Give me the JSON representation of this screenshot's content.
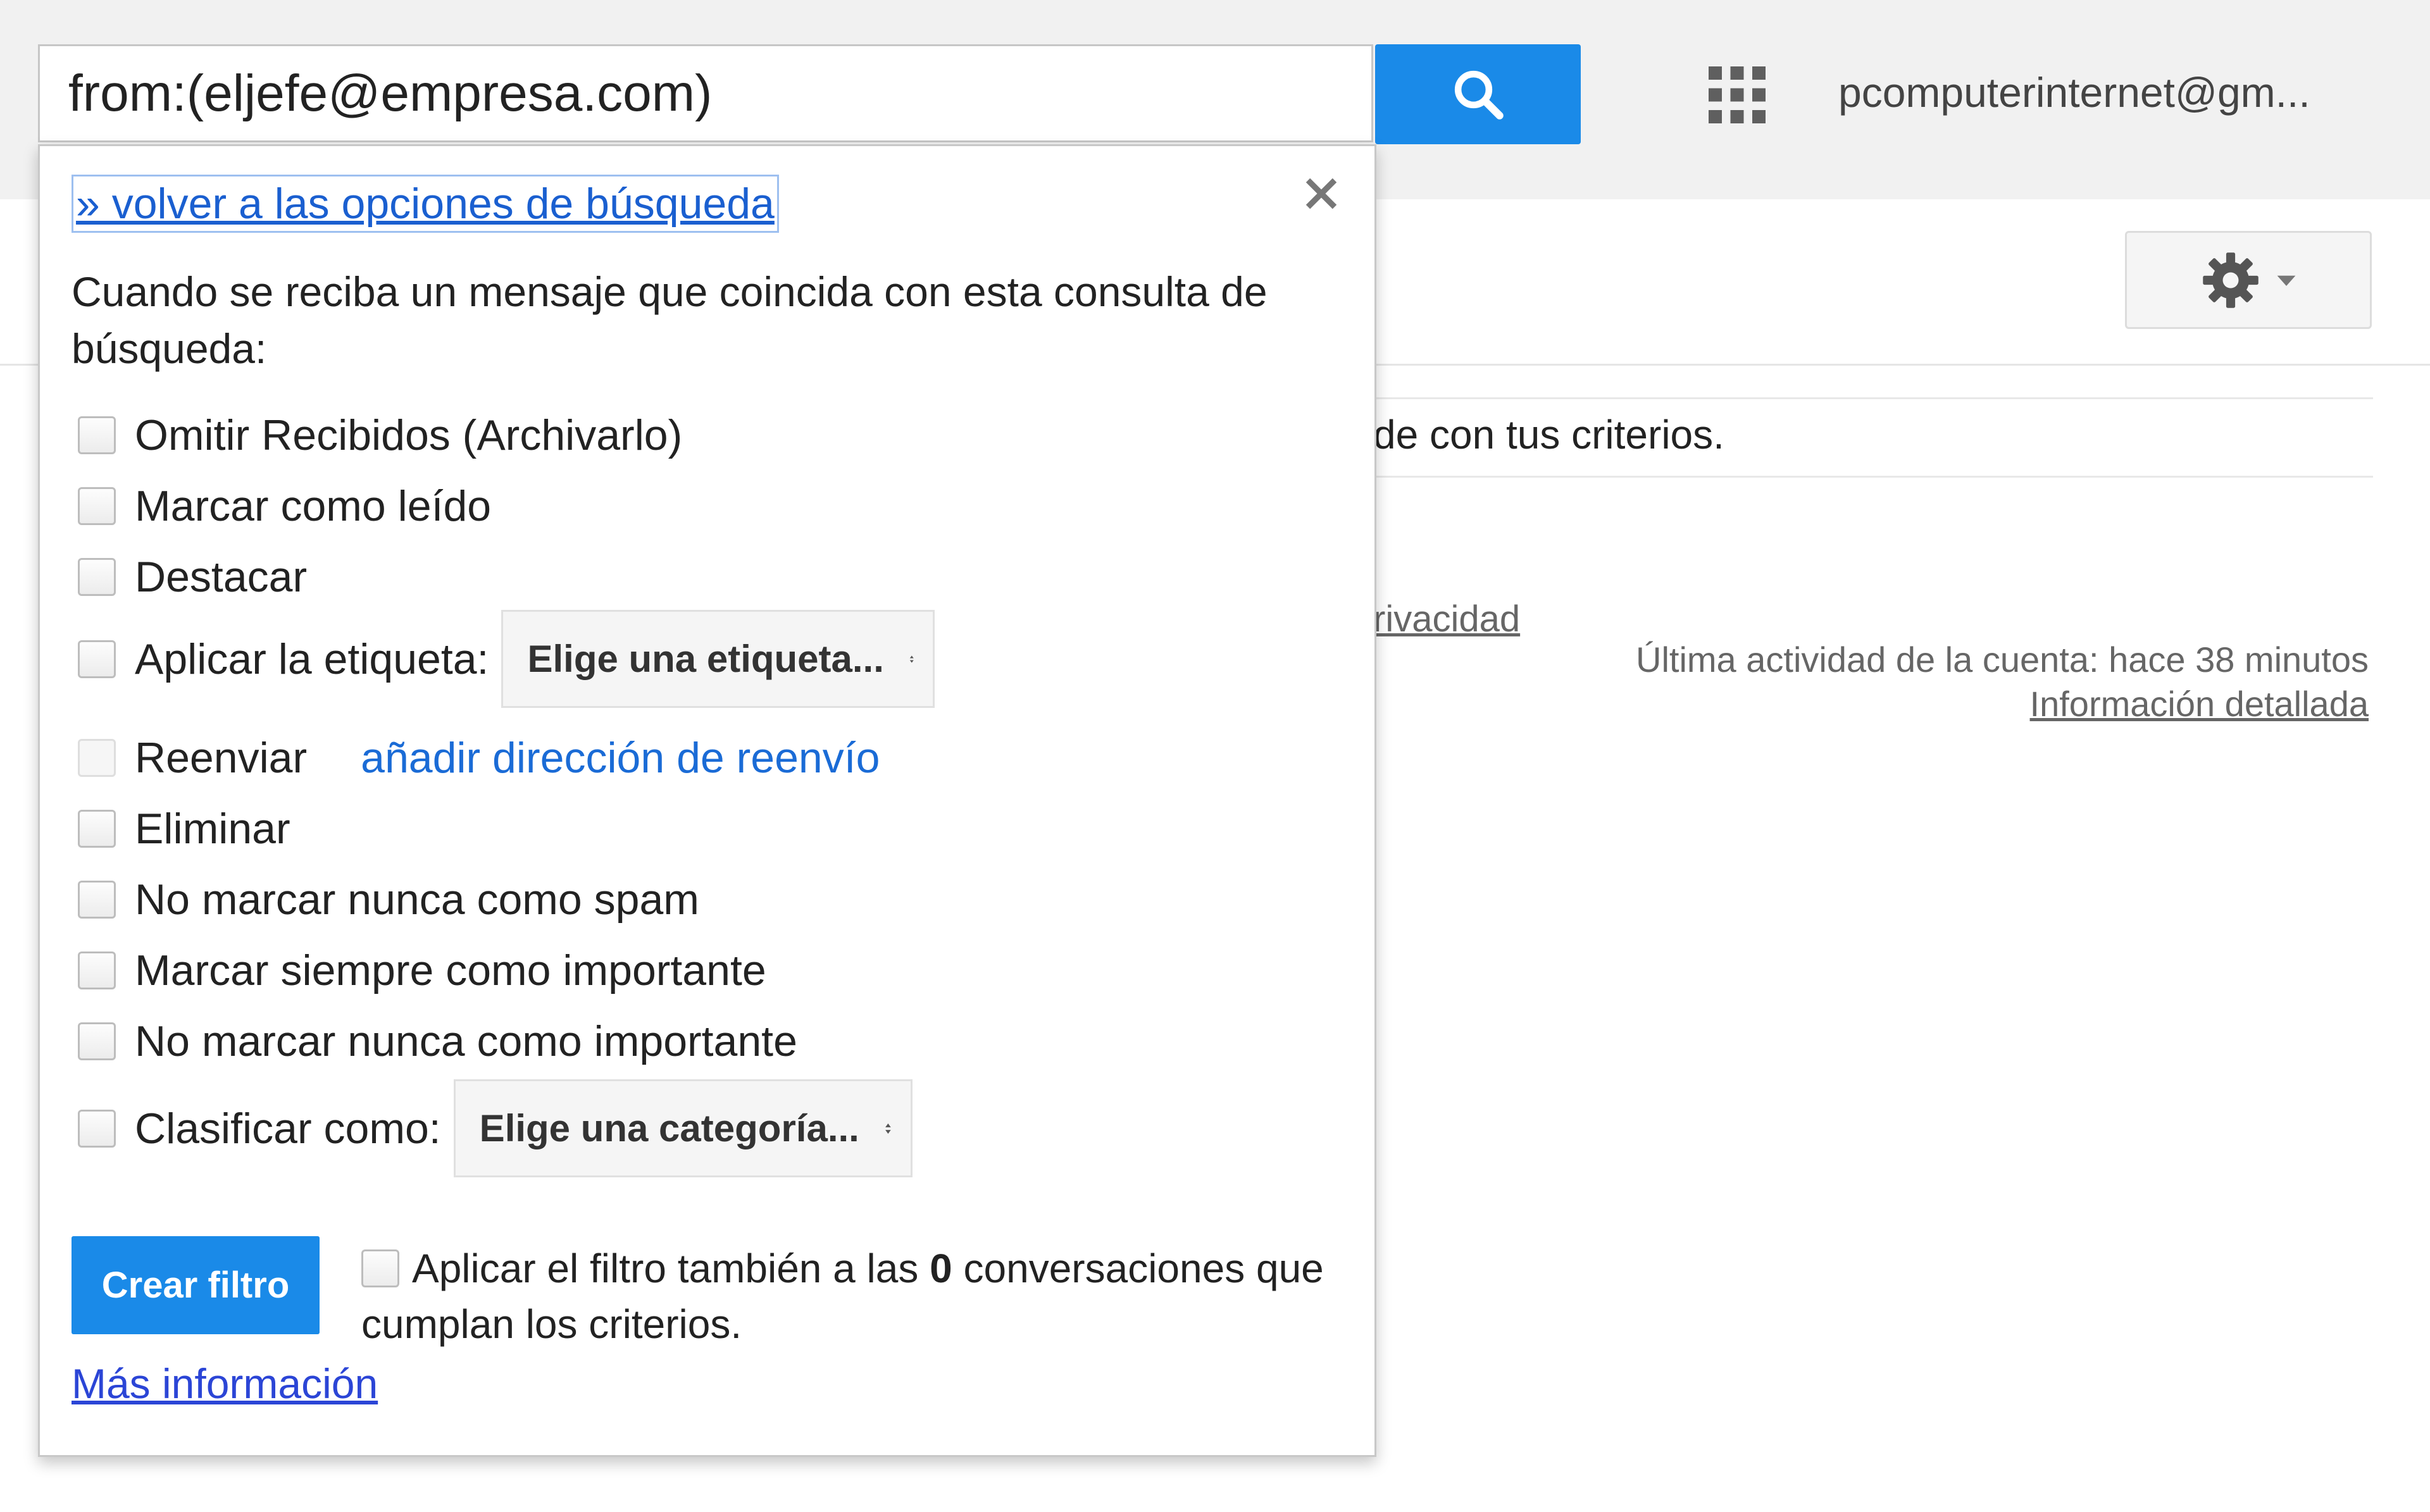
{
  "search": {
    "query": "from:(eljefe@empresa.com)",
    "button_icon": "search-icon"
  },
  "header": {
    "apps_icon": "apps-grid-icon",
    "account": "pcomputerinternet@gm..."
  },
  "toolbar": {
    "settings_icon": "gear-icon"
  },
  "background": {
    "results_text": "de con tus criterios.",
    "privacy_link": "rivacidad",
    "last_activity": "Última actividad de la cuenta: hace 38 minutos",
    "details_link": "Información detallada"
  },
  "filter": {
    "back_link": "» volver a las opciones de búsqueda",
    "close_icon": "close-icon",
    "intro": "Cuando se reciba un mensaje que coincida con esta consulta de búsqueda:",
    "options": {
      "skip_inbox": "Omitir Recibidos (Archivarlo)",
      "mark_read": "Marcar como leído",
      "star": "Destacar",
      "apply_label": "Aplicar la etiqueta:",
      "label_select": "Elige una etiqueta...",
      "forward": "Reenviar",
      "forward_link": "añadir dirección de reenvío",
      "delete": "Eliminar",
      "never_spam": "No marcar nunca como spam",
      "always_important": "Marcar siempre como importante",
      "never_important": "No marcar nunca como importante",
      "categorize": "Clasificar como:",
      "category_select": "Elige una categoría..."
    },
    "create_button": "Crear filtro",
    "apply_pre": "Aplicar el filtro también a las ",
    "apply_count": "0",
    "apply_post": " conversaciones que cumplan los criterios.",
    "more_info": "Más información"
  },
  "colors": {
    "accent": "#1a8ae8",
    "link": "#1a6bd6"
  }
}
